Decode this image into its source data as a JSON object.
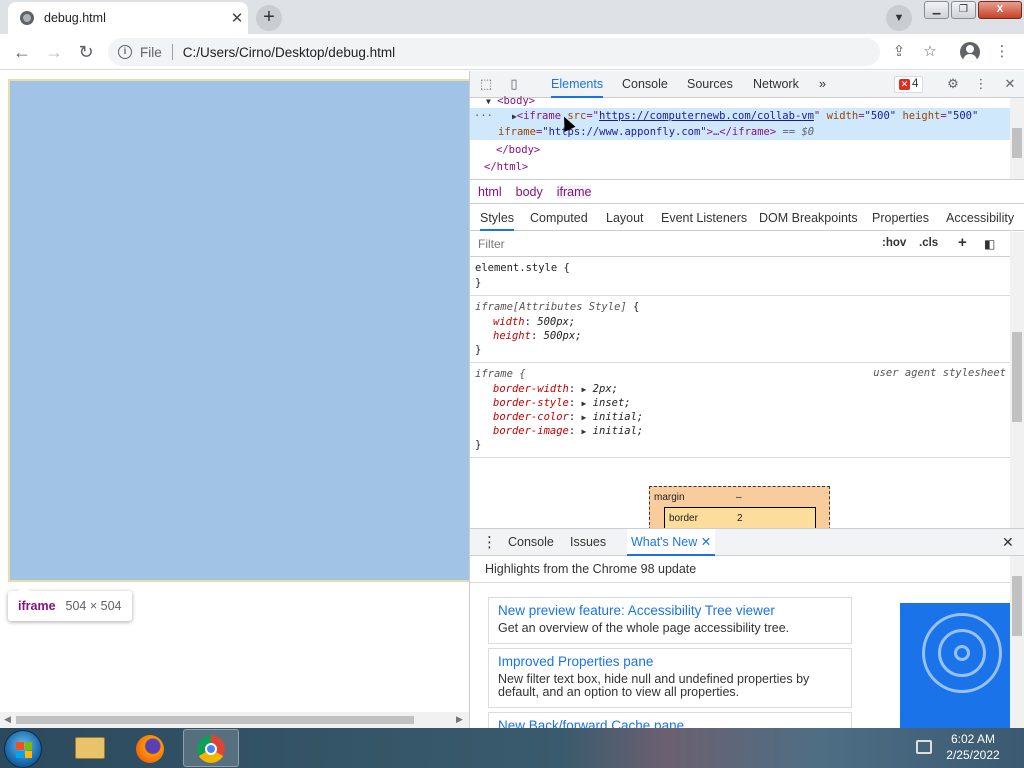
{
  "browser": {
    "tab_title": "debug.html",
    "tab_close": "✕",
    "new_tab": "+",
    "scheme_label": "File",
    "url": "C:/Users/Cirno/Desktop/debug.html"
  },
  "page": {
    "tooltip_tag": "iframe",
    "tooltip_size": "504 × 504",
    "highlight_color": "#a1c3e6"
  },
  "devtools": {
    "tabs": [
      "Elements",
      "Console",
      "Sources",
      "Network"
    ],
    "more_tabs": "»",
    "error_count": "4",
    "dom": {
      "body_open": "<body>",
      "iframe_tag": "<iframe",
      "src_name": "src",
      "src_value": "https://computernewb.com/collab-vm",
      "width_name": "width",
      "width_value": "\"500\"",
      "height_name": "height",
      "height_value": "\"500\"",
      "iframe_attr_name": "iframe",
      "iframe_attr_value": "\"https://www.apponfly.com\"",
      "iframe_close": ">…</iframe>",
      "eq0": "== $0",
      "body_close": "</body>",
      "html_close": "</html>"
    },
    "breadcrumbs": [
      "html",
      "body",
      "iframe"
    ],
    "subtabs": [
      "Styles",
      "Computed",
      "Layout",
      "Event Listeners",
      "DOM Breakpoints",
      "Properties",
      "Accessibility"
    ],
    "filter_placeholder": "Filter",
    "hov": ":hov",
    "cls": ".cls",
    "rules": {
      "element_style": "element.style {",
      "close_brace": "}",
      "attr_selector": "iframe[Attributes Style]",
      "attr_props": [
        {
          "name": "width",
          "value": "500px;"
        },
        {
          "name": "height",
          "value": "500px;"
        }
      ],
      "ua_selector": "iframe {",
      "ua_source": "user agent stylesheet",
      "ua_props": [
        {
          "name": "border-width",
          "value": "2px;"
        },
        {
          "name": "border-style",
          "value": "inset;"
        },
        {
          "name": "border-color",
          "value": "initial;"
        },
        {
          "name": "border-image",
          "value": "initial;"
        }
      ]
    },
    "box_model": {
      "margin_label": "margin",
      "margin_value": "–",
      "border_label": "border",
      "border_value": "2"
    },
    "drawer_tabs": [
      "Console",
      "Issues",
      "What's New"
    ],
    "highlights_title": "Highlights from the Chrome 98 update",
    "cards": [
      {
        "title": "New preview feature: Accessibility Tree viewer",
        "desc": "Get an overview of the whole page accessibility tree."
      },
      {
        "title": "Improved Properties pane",
        "desc": "New filter text box, hide null and undefined properties by default, and an option to view all properties."
      },
      {
        "title": "New Back/forward Cache pane",
        "desc": ""
      }
    ]
  },
  "taskbar": {
    "time": "6:02 AM",
    "date": "2/25/2022"
  }
}
